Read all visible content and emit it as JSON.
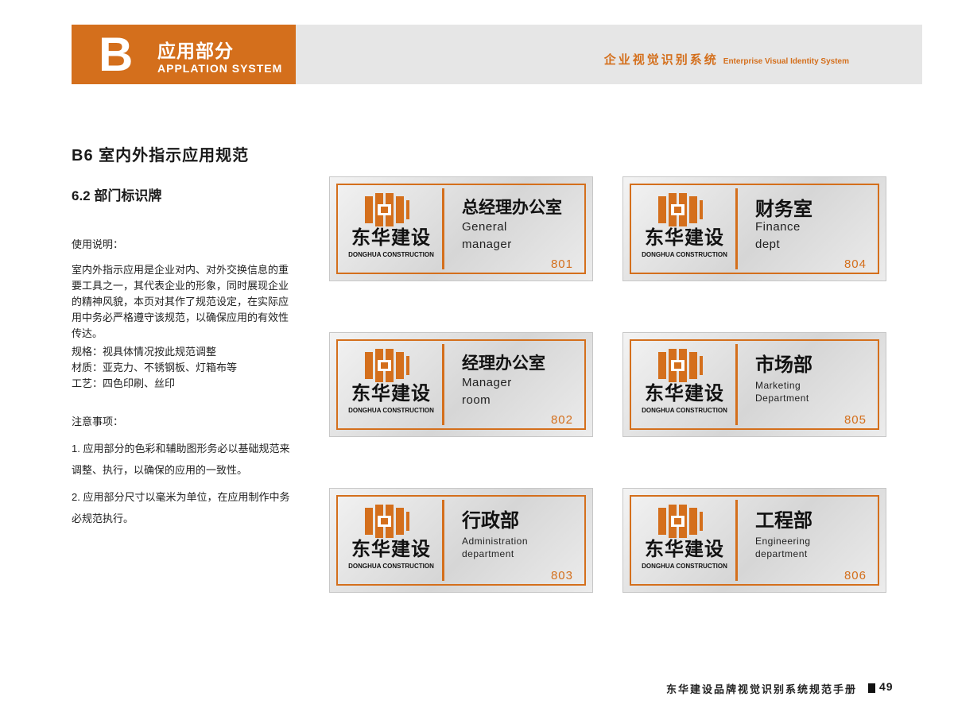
{
  "colors": {
    "accent": "#d46f1c",
    "header_strip": "#e6e6e6",
    "sign_bg": "#dcdcdc"
  },
  "header": {
    "letter": "B",
    "section_cn": "应用部分",
    "section_en": "APPLATION SYSTEM",
    "system_cn": "企业视觉识别系统",
    "system_en": "Enterprise Visual Identity System"
  },
  "section": {
    "title": "B6 室内外指示应用规范",
    "subtitle": "6.2 部门标识牌"
  },
  "usage": {
    "label": "使用说明：",
    "body": "室内外指示应用是企业对内、对外交换信息的重要工具之一，其代表企业的形象，同时展现企业的精神风貌，本页对其作了规范设定，在实际应用中务必严格遵守该规范，以确保应用的有效性传达。",
    "spec": "规格：视具体情况按此规范调整",
    "material": "材质：亚克力、不锈钢板、灯箱布等",
    "process": "工艺：四色印刷、丝印"
  },
  "notes": {
    "label": "注意事项：",
    "items": [
      "1. 应用部分的色彩和辅助图形务必以基础规范来调整、执行，以确保的应用的一致性。",
      "2. 应用部分尺寸以毫米为单位，在应用制作中务必规范执行。"
    ]
  },
  "brand": {
    "cn": "东华建设",
    "en": "DONGHUA CONSTRUCTION",
    "logo_icon": "building-logo-icon"
  },
  "signs": [
    {
      "cn": "总经理办公室",
      "en1": "General",
      "en2": "manager",
      "room": "801"
    },
    {
      "cn": "财务室",
      "en1": "Finance",
      "en2": "dept",
      "room": "804"
    },
    {
      "cn": "经理办公室",
      "en1": "Manager",
      "en2": "room",
      "room": "802"
    },
    {
      "cn": "市场部",
      "en1": "Marketing",
      "en2": "Department",
      "room": "805"
    },
    {
      "cn": "行政部",
      "en1": "Administration",
      "en2": "department",
      "room": "803"
    },
    {
      "cn": "工程部",
      "en1": "Engineering",
      "en2": "department",
      "room": "806"
    }
  ],
  "footer": {
    "title": "东华建设品牌视觉识别系统规范手册",
    "page": "49"
  }
}
